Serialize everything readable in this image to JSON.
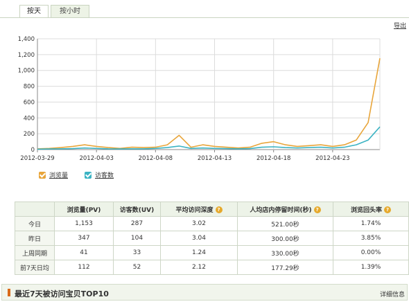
{
  "tabs": [
    {
      "label": "按天",
      "active": true
    },
    {
      "label": "按小时",
      "active": false
    }
  ],
  "export_label": "导出",
  "chart_data": {
    "type": "line",
    "x": [
      "2012-03-29",
      "2012-03-30",
      "2012-03-31",
      "2012-04-01",
      "2012-04-02",
      "2012-04-03",
      "2012-04-04",
      "2012-04-05",
      "2012-04-06",
      "2012-04-07",
      "2012-04-08",
      "2012-04-09",
      "2012-04-10",
      "2012-04-11",
      "2012-04-12",
      "2012-04-13",
      "2012-04-14",
      "2012-04-15",
      "2012-04-16",
      "2012-04-17",
      "2012-04-18",
      "2012-04-19",
      "2012-04-20",
      "2012-04-21",
      "2012-04-22",
      "2012-04-23",
      "2012-04-24",
      "2012-04-25",
      "2012-04-26",
      "2012-04-27"
    ],
    "x_tick_labels": [
      "2012-03-29",
      "2012-04-03",
      "2012-04-08",
      "2012-04-13",
      "2012-04-18",
      "2012-04-23"
    ],
    "series": [
      {
        "name": "浏览量",
        "color": "#e8a53a",
        "values": [
          10,
          15,
          25,
          40,
          60,
          40,
          25,
          15,
          30,
          25,
          30,
          60,
          180,
          30,
          60,
          40,
          30,
          20,
          30,
          80,
          100,
          60,
          40,
          50,
          60,
          40,
          60,
          120,
          340,
          1153
        ]
      },
      {
        "name": "访客数",
        "color": "#3bb3c3",
        "values": [
          5,
          8,
          10,
          12,
          20,
          15,
          10,
          8,
          10,
          10,
          15,
          25,
          45,
          15,
          20,
          15,
          12,
          10,
          12,
          30,
          35,
          25,
          20,
          25,
          30,
          20,
          30,
          60,
          120,
          287
        ]
      }
    ],
    "ylim": [
      0,
      1400
    ],
    "y_ticks": [
      "0",
      "200",
      "400",
      "600",
      "800",
      "1,000",
      "1,200",
      "1,400"
    ],
    "grid": true
  },
  "legend": [
    {
      "label": "浏览量",
      "color": "#e8a53a"
    },
    {
      "label": "访客数",
      "color": "#3bb3c3"
    }
  ],
  "table": {
    "headers": [
      "",
      "浏览量(PV)",
      "访客数(UV)",
      "平均访问深度",
      "人均店内停留时间(秒)",
      "浏览回头率"
    ],
    "help_icons": [
      false,
      false,
      false,
      true,
      true,
      true
    ],
    "rows": [
      [
        "今日",
        "1,153",
        "287",
        "3.02",
        "521.00秒",
        "1.74%"
      ],
      [
        "昨日",
        "347",
        "104",
        "3.04",
        "300.00秒",
        "3.85%"
      ],
      [
        "上周同期",
        "41",
        "33",
        "1.24",
        "330.00秒",
        "0.00%"
      ],
      [
        "前7天日均",
        "112",
        "52",
        "2.12",
        "177.29秒",
        "1.39%"
      ]
    ]
  },
  "bottom": {
    "title": "最近7天被访问宝贝TOP10",
    "link": "详细信息"
  }
}
